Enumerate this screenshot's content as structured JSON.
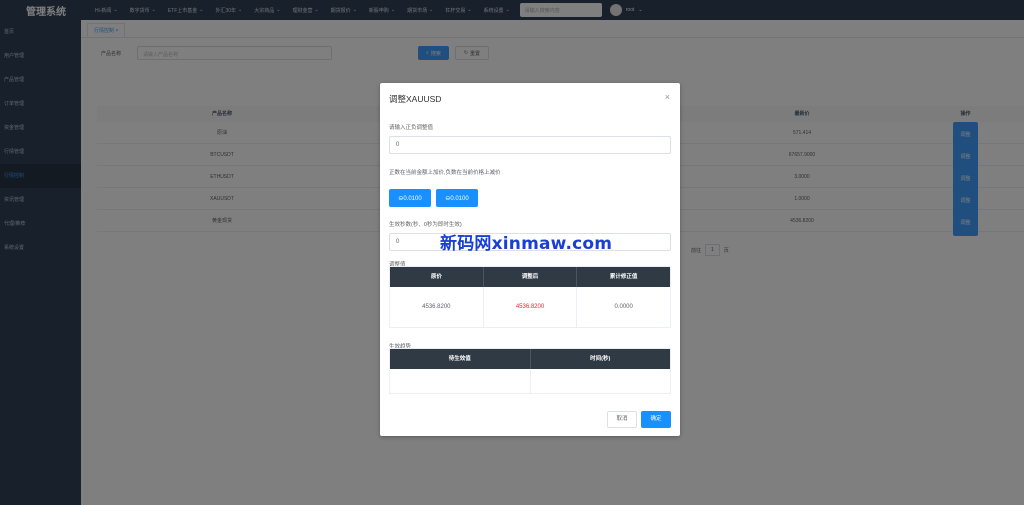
{
  "app": {
    "title": "管理系统"
  },
  "nav": [
    {
      "label": "Hi-新闻"
    },
    {
      "label": "数字货币"
    },
    {
      "label": "ETF上市基金"
    },
    {
      "label": "外汇30年"
    },
    {
      "label": "大宗商品"
    },
    {
      "label": "理财金营"
    },
    {
      "label": "期货报价"
    },
    {
      "label": "新股申购"
    },
    {
      "label": "期货市场"
    },
    {
      "label": "杠杆交易"
    },
    {
      "label": "系统设置"
    }
  ],
  "top_search": {
    "placeholder": "请输入搜索内容"
  },
  "user": {
    "name": "root"
  },
  "sidebar": [
    {
      "label": "首页"
    },
    {
      "label": "用户管理"
    },
    {
      "label": "产品管理"
    },
    {
      "label": "订单管理"
    },
    {
      "label": "资金管理"
    },
    {
      "label": "行情管理"
    },
    {
      "label": "行情控制"
    },
    {
      "label": "资讯管理"
    },
    {
      "label": "代理/推荐"
    },
    {
      "label": "系统设置"
    }
  ],
  "tab": {
    "label": "行情控制 ×"
  },
  "filter": {
    "label": "产品名称",
    "placeholder": "请输入产品名称",
    "search_label": "搜索",
    "reset_label": "重置"
  },
  "table": {
    "headers": [
      "产品名称",
      "",
      "最新价",
      "操作"
    ],
    "rows": [
      {
        "name": "原油",
        "price": "571.414",
        "op": "调整"
      },
      {
        "name": "BTCUSDT",
        "price": "67657.9000",
        "op": "调整"
      },
      {
        "name": "ETHUSDT",
        "price": "3.0000",
        "op": "调整"
      },
      {
        "name": "XAUUSDT",
        "price": "1.0000",
        "op": "调整"
      },
      {
        "name": "黄金现货",
        "price": "4536.8200",
        "op": "调整"
      }
    ],
    "pager_prefix": "前往",
    "pager_page": "1",
    "pager_suffix": "页"
  },
  "dialog": {
    "title": "调整XAUUSD",
    "close_icon": "close-icon",
    "input_label": "请输入正负调整值",
    "input_value": "0",
    "hint": "正数在当前金额上加价,负数在当前价格上减价",
    "minus_button": "⊖0.0100",
    "plus_button": "⊖0.0100",
    "effective_label": "生效秒数(秒、0秒为即时生效)",
    "effective_value": "0",
    "adjust_title": "调整值",
    "adjust_headers": [
      "原价",
      "调整后",
      "累计修正值"
    ],
    "adjust_values": [
      "4536.8200",
      "4536.8200",
      "0.0000"
    ],
    "effective_title": "生效趋势",
    "effective_headers": [
      "待生效值",
      "时间(秒)"
    ],
    "cancel_label": "取消",
    "confirm_label": "确定"
  },
  "watermark": "新码网xinmaw.com",
  "colors": {
    "primary": "#1890ff",
    "adjusted_value": "#f5222d",
    "table_header": "#2f3a45"
  }
}
